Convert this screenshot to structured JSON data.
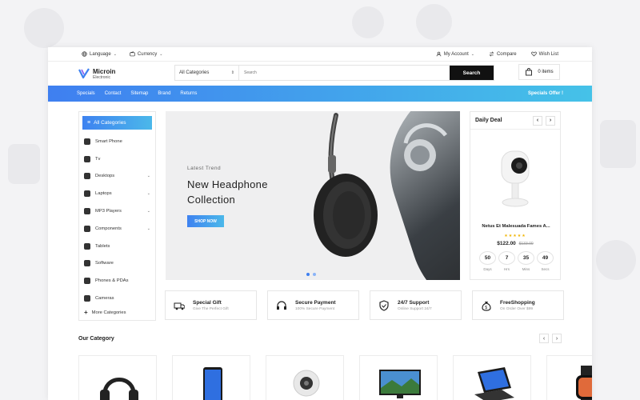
{
  "topbar": {
    "language": "Language",
    "currency": "Currency",
    "my_account": "My Account",
    "compare": "Compare",
    "wish_list": "Wish List"
  },
  "header": {
    "brand": "Microin",
    "brand_sub": "Electronic",
    "search_category": "All Categories",
    "search_placeholder": "Search",
    "search_button": "Search",
    "cart_label": "0 items"
  },
  "nav": {
    "links": [
      "Specials",
      "Contact",
      "Sitemap",
      "Brand",
      "Returns"
    ],
    "offer": "Specials Offer !"
  },
  "sidebar": {
    "heading": "All Categories",
    "items": [
      {
        "label": "Smart Phone",
        "has_sub": false
      },
      {
        "label": "Tv",
        "has_sub": false
      },
      {
        "label": "Desktops",
        "has_sub": true
      },
      {
        "label": "Laptops",
        "has_sub": true
      },
      {
        "label": "MP3 Players",
        "has_sub": true
      },
      {
        "label": "Components",
        "has_sub": true
      },
      {
        "label": "Tablets",
        "has_sub": false
      },
      {
        "label": "Software",
        "has_sub": false
      },
      {
        "label": "Phones & PDAs",
        "has_sub": false
      },
      {
        "label": "Cameras",
        "has_sub": false
      }
    ],
    "more": "More Categories"
  },
  "banner": {
    "kicker": "Latest Trend",
    "title_line1": "New Headphone",
    "title_line2": "Collection",
    "cta": "SHOP NOW",
    "slide_count": 2,
    "active_slide": 1
  },
  "deal": {
    "heading": "Daily Deal",
    "product_name": "Netus Et Malesuada Fames A...",
    "stars": "★★★★★",
    "price": "$122.00",
    "old_price": "$133.00",
    "timer": [
      {
        "value": "50",
        "label": "Days"
      },
      {
        "value": "7",
        "label": "Hrs"
      },
      {
        "value": "35",
        "label": "Mins"
      },
      {
        "value": "49",
        "label": "Secs"
      }
    ]
  },
  "features": [
    {
      "title": "Special Gift",
      "sub": "Give The Perfect Gift",
      "icon": "truck-icon"
    },
    {
      "title": "Secure Payment",
      "sub": "100% Secure Payment",
      "icon": "headset-icon"
    },
    {
      "title": "24/7 Support",
      "sub": "Online Support 24/7",
      "icon": "shield-icon"
    },
    {
      "title": "FreeShopping",
      "sub": "On Order Over $99",
      "icon": "money-bag-icon"
    }
  ],
  "our_category": {
    "title": "Our Category"
  },
  "colors": {
    "accent_start": "#3e82f0",
    "accent_end": "#4bb8ea",
    "dark": "#111111"
  }
}
